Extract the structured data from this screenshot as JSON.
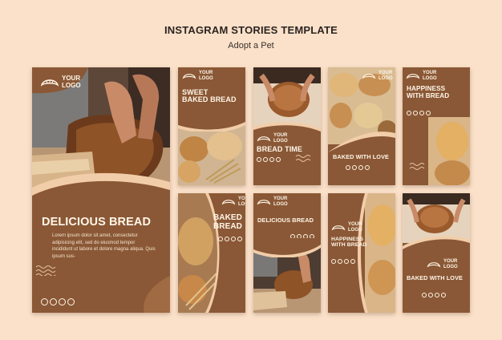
{
  "header": {
    "title": "INSTAGRAM STORIES TEMPLATE",
    "subtitle": "Adopt a Pet"
  },
  "logo": {
    "line1": "YOUR",
    "line2": "LOGO",
    "icon": "croissant-icon"
  },
  "cards": {
    "large": {
      "headline": "DELICIOUS BREAD",
      "body": "Lorem ipsum dolor sit amet, consectetur adipisicing elit, sed do eiusmod tempor incididunt ut labore et dolore magna aliqua. Quis ipsum sus-"
    },
    "sweet": {
      "headline_l1": "SWEET",
      "headline_l2": "BAKED BREAD"
    },
    "time": {
      "headline": "BREAD TIME"
    },
    "love1": {
      "headline": "BAKED WITH LOVE"
    },
    "happy1": {
      "headline_l1": "HAPPINESS",
      "headline_l2": "WITH BREAD"
    },
    "baked": {
      "headline_l1": "BAKED",
      "headline_l2": "BREAD"
    },
    "delicious": {
      "headline": "DELICIOUS BREAD"
    },
    "happy2": {
      "headline_l1": "HAPPINESS",
      "headline_l2": "WITH BREAD"
    },
    "love2": {
      "headline": "BAKED WITH LOVE"
    }
  },
  "social_icons": [
    "instagram-icon",
    "facebook-icon",
    "twitter-icon",
    "pinterest-icon"
  ],
  "colors": {
    "background": "#fbe1c9",
    "card": "#8a5836",
    "cream": "#f6d9bd",
    "text": "#fff6e8"
  }
}
